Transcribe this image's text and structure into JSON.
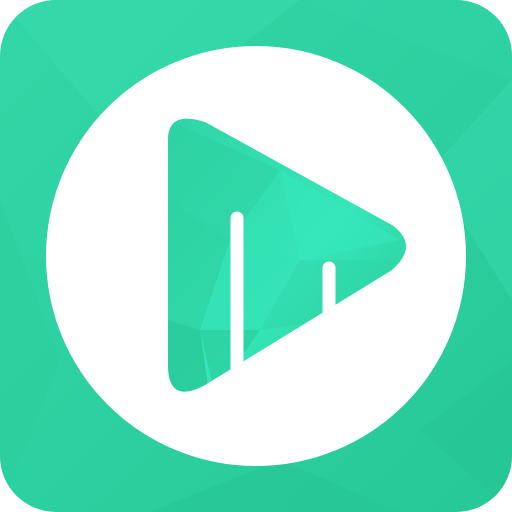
{
  "icon": {
    "name": "play-with-bars-app-icon",
    "colors": {
      "background_primary": "#2cd3a3",
      "background_light": "#3ee0b0",
      "background_dark": "#25c794",
      "circle": "#ffffff",
      "triangle_light": "#33e7b8",
      "triangle_mid": "#2fd8a8",
      "triangle_dark": "#27c592",
      "bars": "#ffffff"
    }
  }
}
